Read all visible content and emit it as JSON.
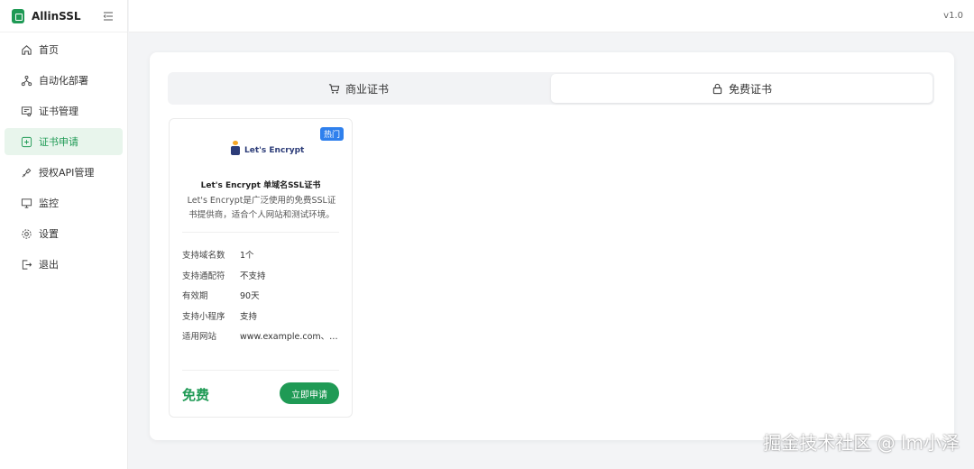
{
  "app": {
    "title": "AllinSSL",
    "version": "v1.0"
  },
  "sidebar": {
    "items": [
      {
        "label": "首页",
        "icon": "home-icon"
      },
      {
        "label": "自动化部署",
        "icon": "workflow-icon"
      },
      {
        "label": "证书管理",
        "icon": "certificate-icon"
      },
      {
        "label": "证书申请",
        "icon": "add-icon",
        "active": true
      },
      {
        "label": "授权API管理",
        "icon": "api-key-icon"
      },
      {
        "label": "监控",
        "icon": "monitor-icon"
      },
      {
        "label": "设置",
        "icon": "gear-icon"
      },
      {
        "label": "退出",
        "icon": "logout-icon"
      }
    ]
  },
  "tabs": [
    {
      "label": "商业证书",
      "icon": "cart-icon"
    },
    {
      "label": "免费证书",
      "icon": "lock-icon",
      "active": true
    }
  ],
  "product": {
    "badge": "热门",
    "logo_text": "Let's Encrypt",
    "name": "Let's Encrypt 单域名SSL证书",
    "description": "Let's Encrypt是广泛使用的免费SSL证书提供商，适合个人网站和测试环境。",
    "specs": [
      {
        "key": "支持域名数",
        "value": "1个"
      },
      {
        "key": "支持通配符",
        "value": "不支持"
      },
      {
        "key": "有效期",
        "value": "90天"
      },
      {
        "key": "支持小程序",
        "value": "支持"
      },
      {
        "key": "适用网站",
        "value": "www.example.com、example.com"
      }
    ],
    "price": "免费",
    "apply_label": "立即申请"
  },
  "watermark": "掘金技术社区 @ lm小泽",
  "colors": {
    "accent": "#1f9a55",
    "badge": "#2f80ed",
    "active_bg": "#e8f5ec"
  }
}
